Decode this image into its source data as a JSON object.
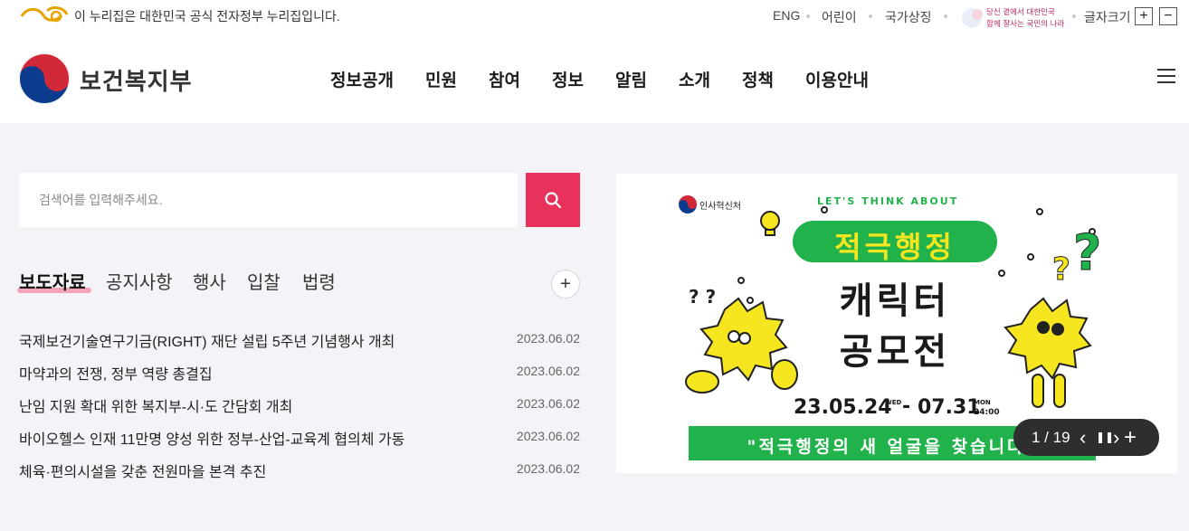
{
  "top_bar": {
    "gov_notice": "이 누리집은 대한민국 공식 전자정부 누리집입니다.",
    "links": [
      "ENG",
      "어린이",
      "국가상징"
    ],
    "slogan": "당신 곁에서 대한민국 함께 잘사는 국민의 나라",
    "font_size_label": "글자크기",
    "font_increase": "+",
    "font_decrease": "−"
  },
  "header": {
    "logo_text": "보건복지부",
    "nav": [
      "정보공개",
      "민원",
      "참여",
      "정보",
      "알림",
      "소개",
      "정책",
      "이용안내"
    ]
  },
  "search": {
    "placeholder": "검색어를 입력해주세요.",
    "value": ""
  },
  "news": {
    "tabs": [
      "보도자료",
      "공지사항",
      "행사",
      "입찰",
      "법령"
    ],
    "active_tab": "보도자료",
    "more": "+",
    "items": [
      {
        "title": "국제보건기술연구기금(RIGHT) 재단 설립 5주년 기념행사 개최",
        "date": "2023.06.02"
      },
      {
        "title": "마약과의 전쟁, 정부 역량 총결집",
        "date": "2023.06.02"
      },
      {
        "title": "난임 지원 확대 위한 복지부-시·도 간담회 개최",
        "date": "2023.06.02"
      },
      {
        "title": "바이오헬스 인재 11만명 양성 위한 정부-산업-교육계 협의체 가동",
        "date": "2023.06.02"
      },
      {
        "title": "체육·편의시설을 갖춘 전원마을 본격 추진",
        "date": "2023.06.02"
      }
    ]
  },
  "banner": {
    "org": "인사혁신처",
    "kicker": "LET'S THINK ABOUT",
    "title_line1": "적극행정",
    "title_line2": "캐릭터",
    "title_line3": "공모전",
    "period_start": "23.05.24",
    "period_start_day": "WED",
    "period_sep": "-",
    "period_end": "07.31",
    "period_end_day": "MON",
    "period_end_time": "24:00",
    "caption": "\"적극행정의 새 얼굴을 찾습니다\"",
    "q1": "? ?",
    "q2": "?",
    "q3": "?"
  },
  "pager": {
    "current": "1",
    "total": "19",
    "display": "1 / 19",
    "prev": "‹",
    "pause": "❚❚",
    "next": "›",
    "add": "+"
  },
  "colors": {
    "accent": "#e8315b",
    "banner_green": "#22b24c",
    "banner_yellow": "#f5e61f",
    "page_bg": "#f3f3f8"
  }
}
